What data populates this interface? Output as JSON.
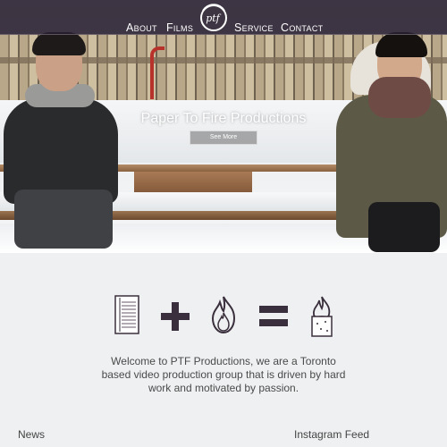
{
  "nav": {
    "items": [
      "About",
      "Films",
      "Service",
      "Contact"
    ],
    "logo_text": "ptf"
  },
  "hero": {
    "title": "Paper To Fire Productions",
    "cta_label": "See More"
  },
  "equation_icons": [
    "paper-icon",
    "plus-icon",
    "fire-icon",
    "equals-icon",
    "burning-paper-icon"
  ],
  "welcome_text": "Welcome to PTF Productions, we are a Toronto based video production group that is driven by hard work and motivated by passion.",
  "sections": {
    "news": "News",
    "instagram": "Instagram Feed"
  },
  "colors": {
    "nav_background": "#281e2e",
    "icon_color": "#3a2f3c",
    "page_background": "#eef0f1"
  }
}
